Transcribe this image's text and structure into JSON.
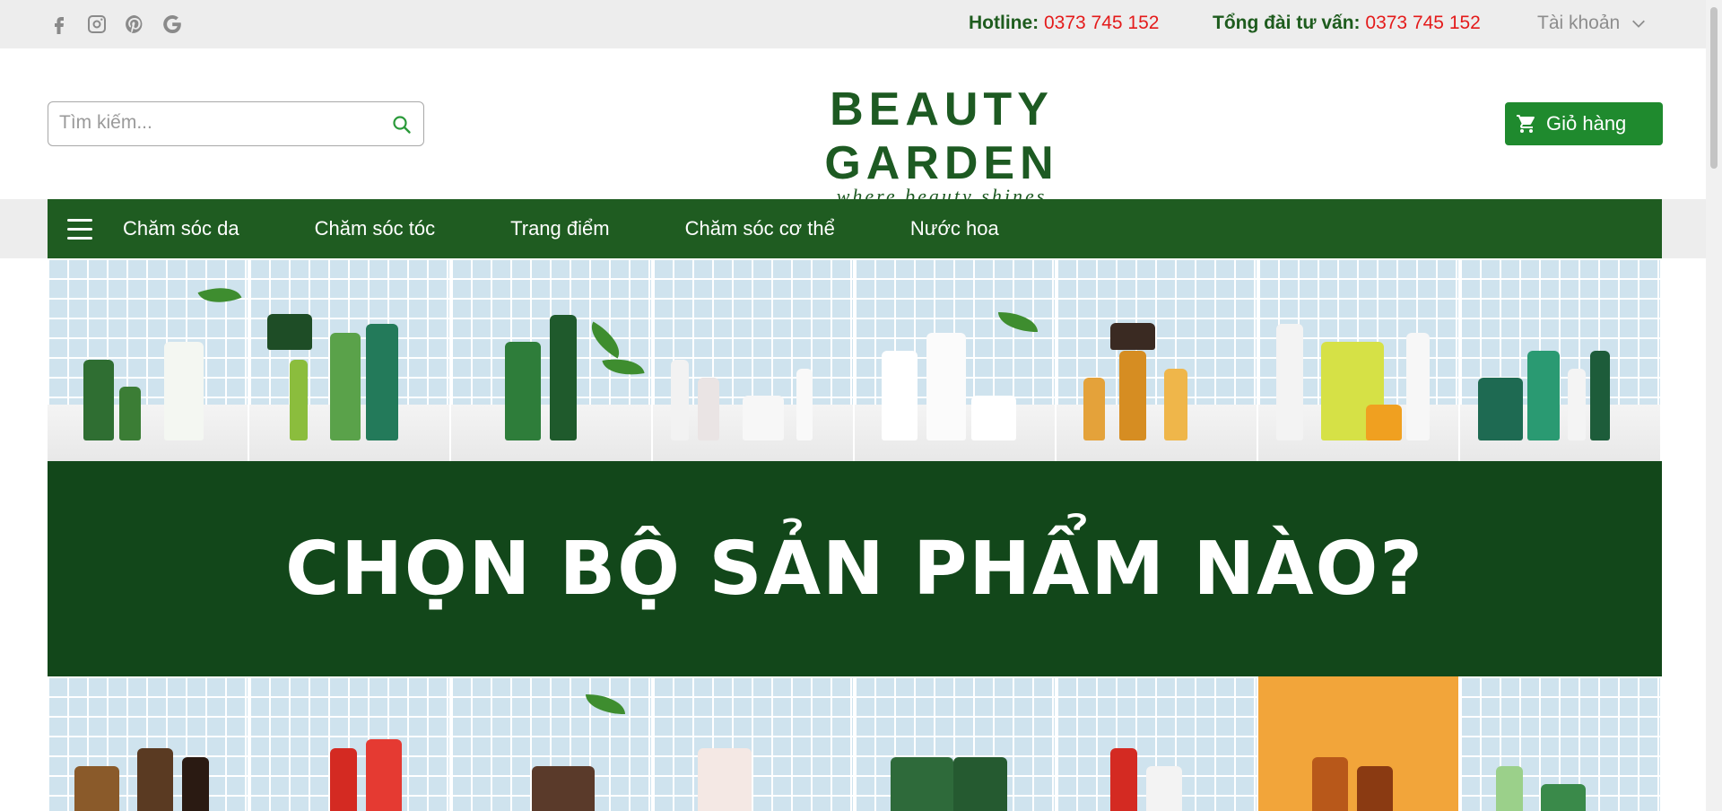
{
  "topbar": {
    "social": [
      {
        "icon": "facebook-icon"
      },
      {
        "icon": "instagram-icon"
      },
      {
        "icon": "pinterest-icon"
      },
      {
        "icon": "google-icon"
      }
    ],
    "hotline_label": "Hotline:",
    "hotline_number": "0373 745 152",
    "consult_label": "Tổng đài tư vấn:",
    "consult_number": "0373 745 152",
    "account_label": "Tài khoản"
  },
  "header": {
    "search_placeholder": "Tìm kiếm...",
    "logo_name": "BEAUTY GARDEN",
    "logo_tagline": "where beauty shines",
    "cart_label": "Giỏ hàng"
  },
  "nav": {
    "items": [
      {
        "label": "Chăm sóc da"
      },
      {
        "label": "Chăm sóc tóc"
      },
      {
        "label": "Trang điểm"
      },
      {
        "label": "Chăm sóc cơ thể"
      },
      {
        "label": "Nước hoa"
      }
    ]
  },
  "banner": {
    "headline": "CHỌN BỘ SẢN PHẨM NÀO?"
  },
  "colors": {
    "brand_green": "#1f5c21",
    "banner_green": "#12471a",
    "cart_green": "#1f8a2e",
    "phone_red": "#e41b1b"
  }
}
